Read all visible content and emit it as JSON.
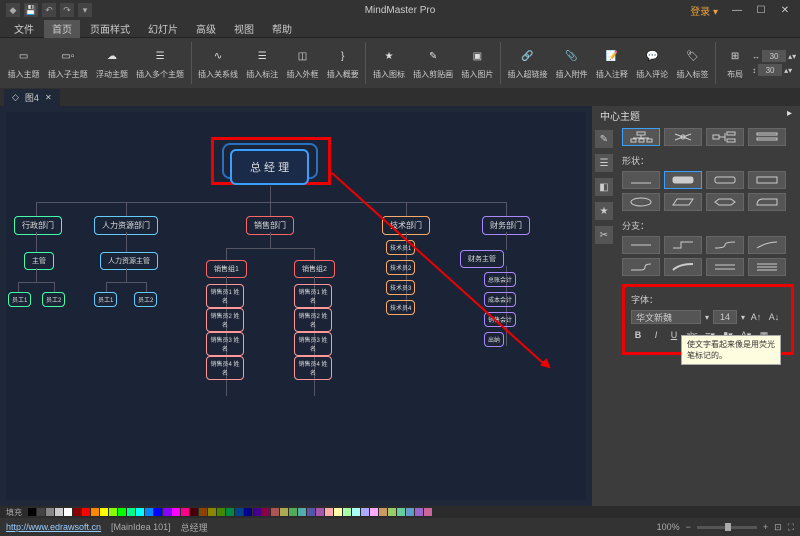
{
  "app": {
    "title": "MindMaster Pro"
  },
  "titlebar": {
    "login": "登录 ▾"
  },
  "menu": {
    "items": [
      "文件",
      "首页",
      "页面样式",
      "幻灯片",
      "高级",
      "视图",
      "帮助"
    ],
    "active_index": 1
  },
  "ribbon": {
    "buttons": [
      "插入主题",
      "插入子主题",
      "浮动主题",
      "插入多个主题",
      "插入关系线",
      "插入标注",
      "插入外框",
      "插入概要",
      "插入图标",
      "插入剪贴画",
      "插入图片",
      "插入超链接",
      "插入附件",
      "插入注释",
      "插入评论",
      "插入标签",
      "布局"
    ],
    "spacing_value": "30",
    "spacing_value2": "30"
  },
  "document": {
    "tab_label": "图4"
  },
  "mindmap": {
    "root": "总 经 理",
    "level1": [
      "行政部门",
      "人力资源部门",
      "销售部门",
      "技术部门",
      "财务部门"
    ],
    "admin": {
      "mgr": "主管",
      "staff": [
        "员工1",
        "员工2"
      ]
    },
    "hr": {
      "mgr": "人力资源主管",
      "staff": [
        "员工1",
        "员工2"
      ]
    },
    "sales": {
      "groups": [
        "销售组1",
        "销售组2"
      ],
      "members": [
        "销售员1 姓名",
        "销售员2 姓名",
        "销售员3 姓名",
        "销售员4 姓名"
      ]
    },
    "tech": {
      "staff": [
        "技术员1",
        "技术员2",
        "技术员3",
        "技术员4"
      ]
    },
    "finance": {
      "mgr": "财务主管",
      "staff": [
        "总账会计",
        "成本会计",
        "销售会计",
        "出纳"
      ]
    }
  },
  "sidepanel": {
    "title": "中心主题",
    "sections": {
      "shape": "形状：",
      "branch": "分支：",
      "font": "字体："
    },
    "font_name": "华文新魏",
    "font_size": "14",
    "tooltip": "使文字看起来像是用荧光笔标记的。"
  },
  "statusbar": {
    "fill_label": "填充",
    "url": "http://www.edrawsoft.cn",
    "doc_info": "[MainIdea 101]",
    "selection": "总经理",
    "zoom": "100%"
  },
  "palette": {
    "colors": [
      "#000",
      "#444",
      "#888",
      "#ccc",
      "#fff",
      "#800",
      "#f00",
      "#f80",
      "#ff0",
      "#8f0",
      "#0f0",
      "#0f8",
      "#0ff",
      "#08f",
      "#00f",
      "#80f",
      "#f0f",
      "#f08",
      "#400",
      "#840",
      "#880",
      "#480",
      "#084",
      "#048",
      "#008",
      "#408",
      "#804",
      "#a55",
      "#aa5",
      "#5a5",
      "#5aa",
      "#55a",
      "#a5a",
      "#faa",
      "#ffa",
      "#afa",
      "#aff",
      "#aaf",
      "#faf",
      "#c96",
      "#9c6",
      "#6c9",
      "#69c",
      "#96c",
      "#c69"
    ]
  }
}
